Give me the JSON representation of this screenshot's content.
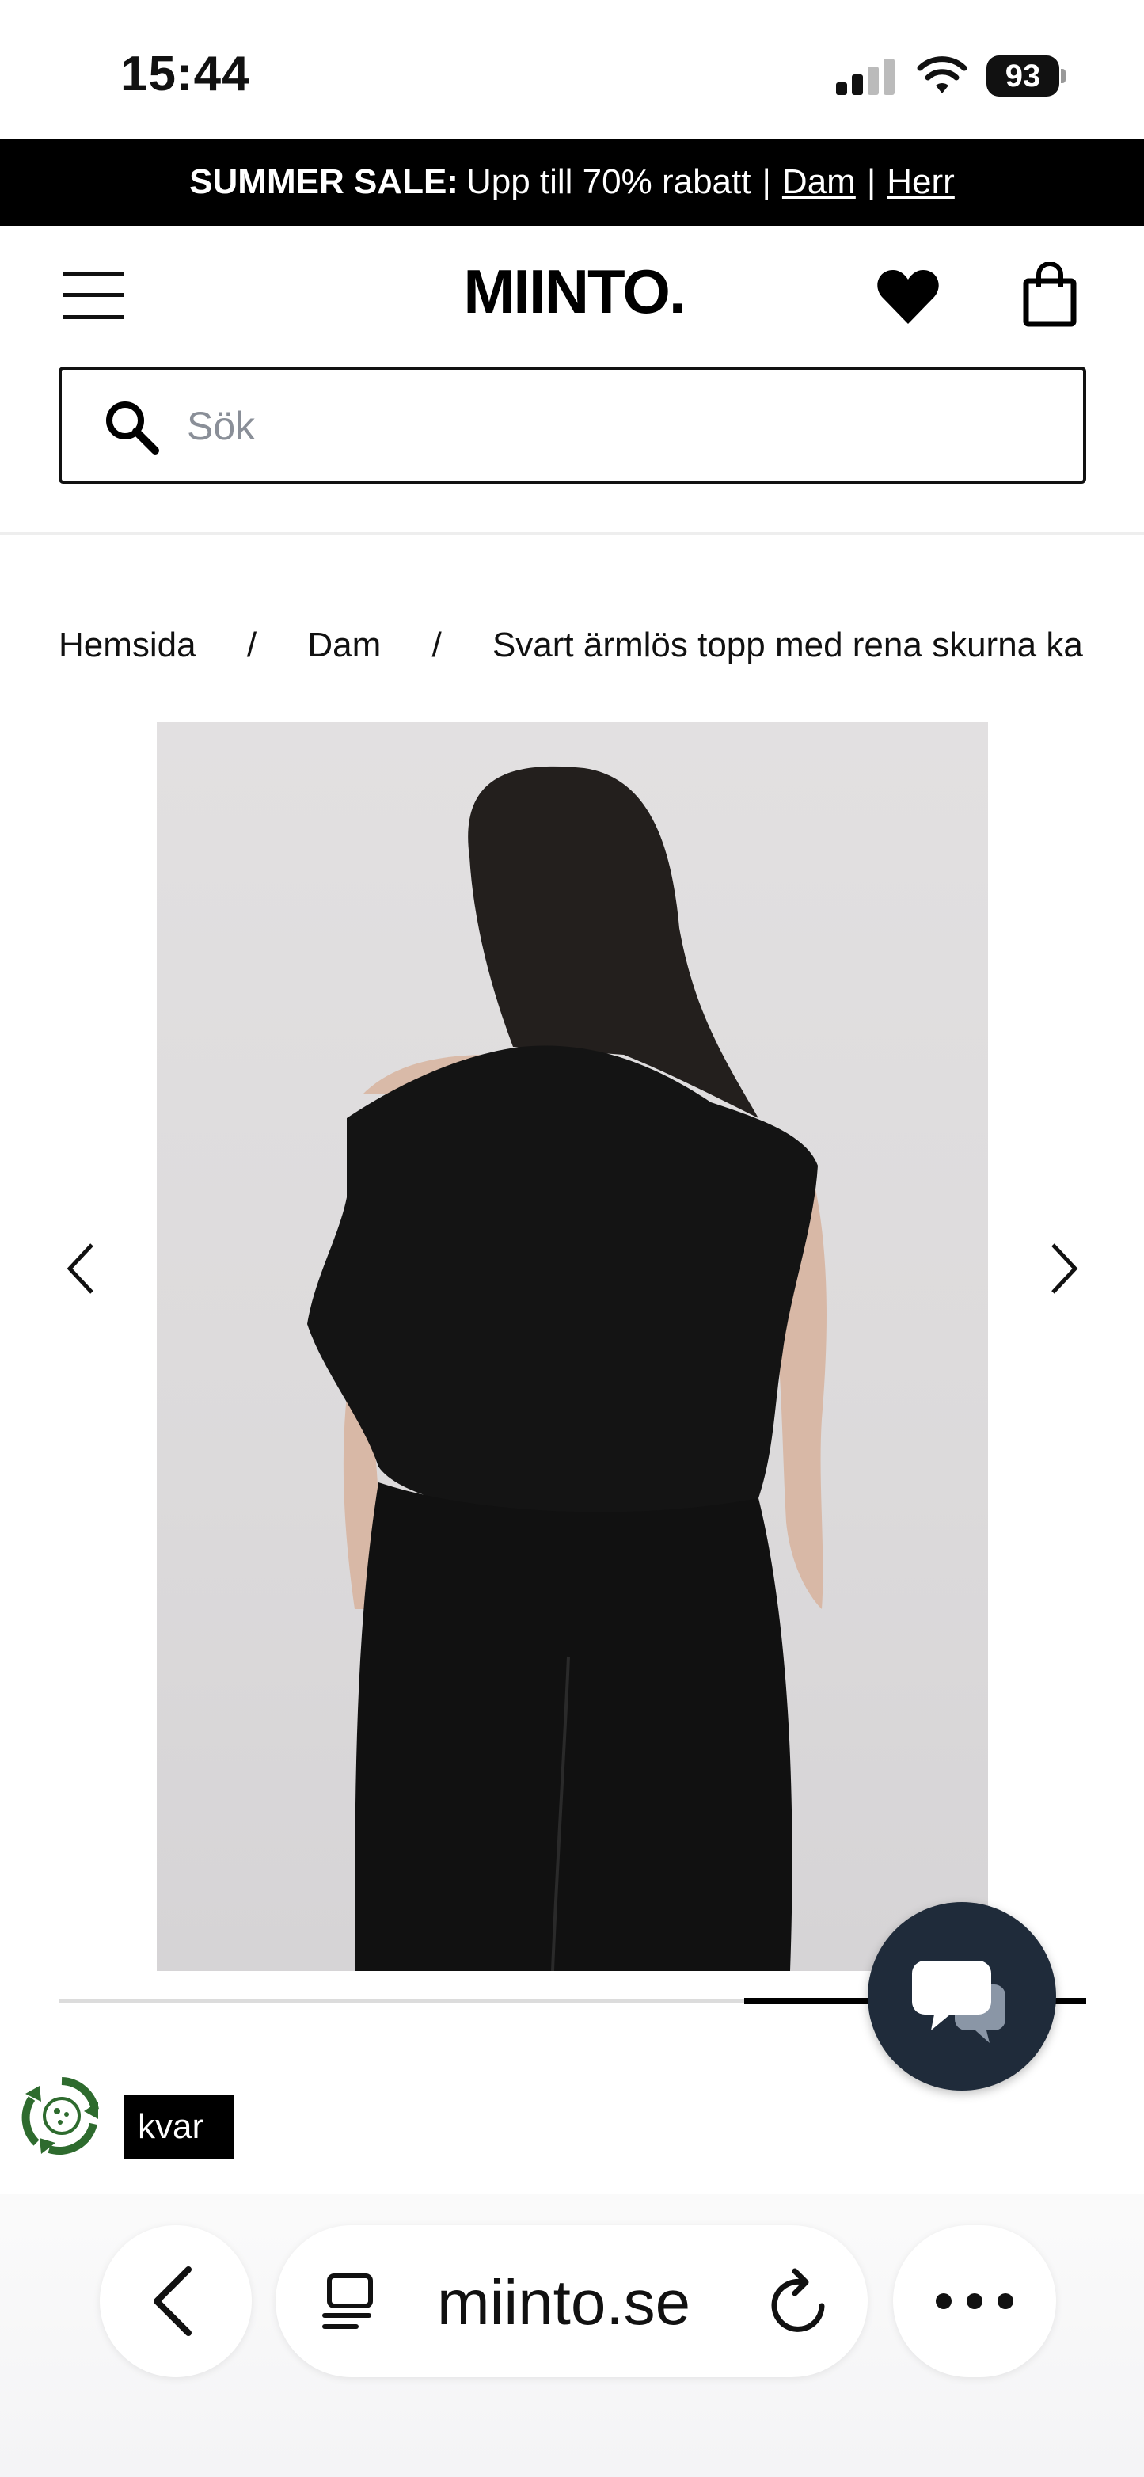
{
  "status_bar": {
    "time": "15:44",
    "battery": "93"
  },
  "promo": {
    "label": "SUMMER SALE:",
    "text": "Upp till 70% rabatt",
    "links": [
      "Dam",
      "Herr"
    ]
  },
  "header": {
    "logo": "MIINTO."
  },
  "search": {
    "placeholder": "Sök"
  },
  "breadcrumb": {
    "items": [
      "Hemsida",
      "Dam",
      "Svart ärmlös topp med rena skurna ka"
    ]
  },
  "product": {
    "stock_label": "kvar"
  },
  "browser": {
    "url": "miinto.se"
  },
  "colors": {
    "promo_bg": "#000000",
    "chat_button": "#1f2b3a",
    "eco_green": "#2e6b2e"
  }
}
